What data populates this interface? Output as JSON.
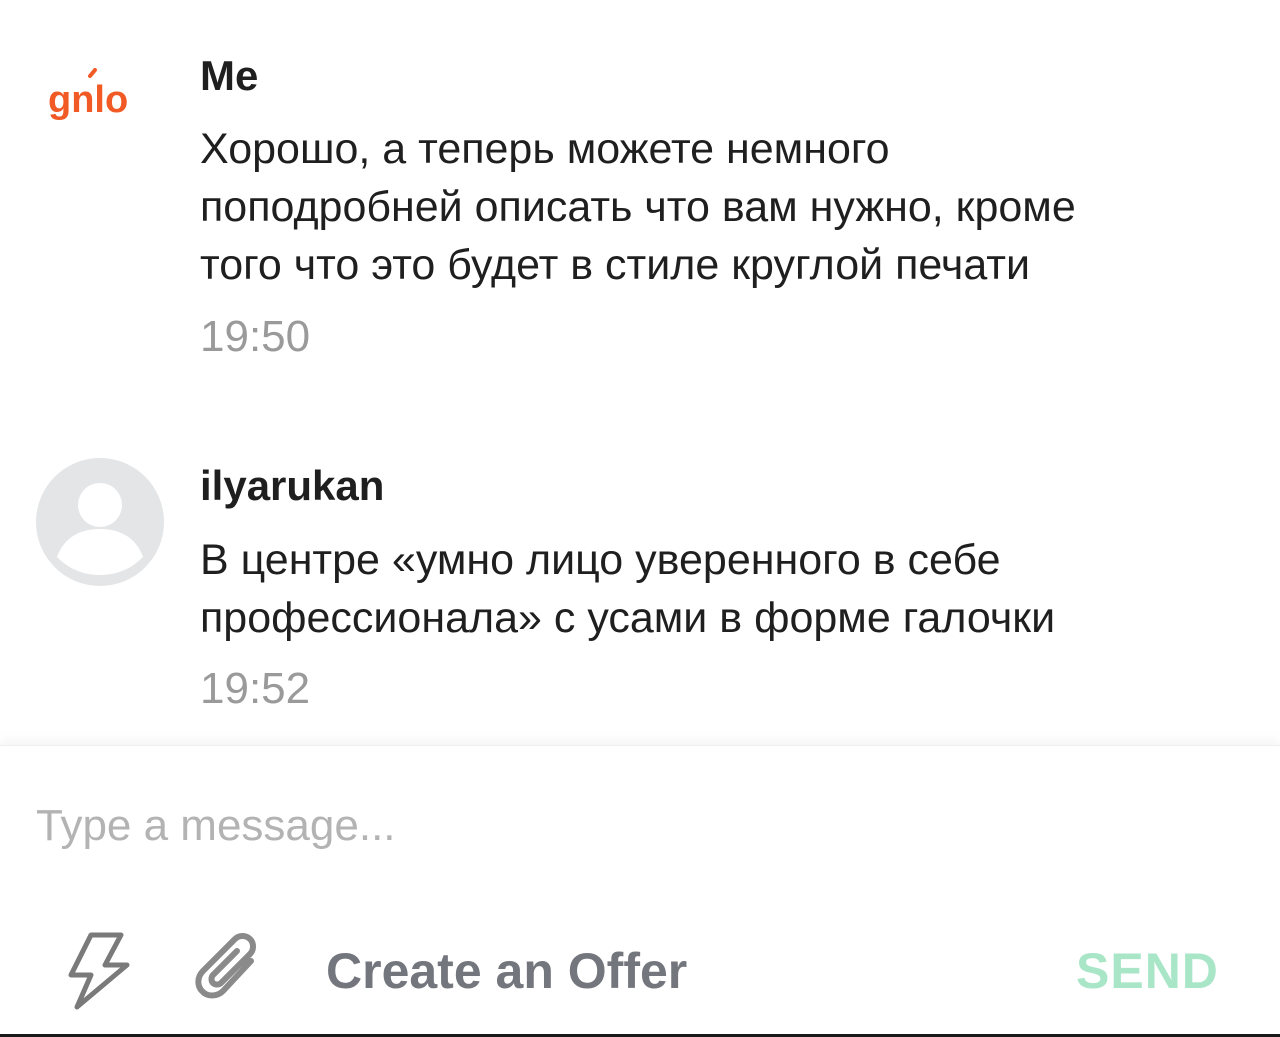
{
  "messages": [
    {
      "sender": "Me",
      "avatar": "gnlo-logo",
      "avatar_text": "gnlo",
      "lines": [
        "Хорошо, а теперь можете немного",
        "поподробней описать что вам нужно, кроме",
        "того что это будет в стиле круглой печати"
      ],
      "time": "19:50"
    },
    {
      "sender": "ilyarukan",
      "avatar": "user-placeholder-icon",
      "lines": [
        "В центре «умно лицо уверенного в себе",
        "профессионала» с усами в форме галочки"
      ],
      "time": "19:52"
    }
  ],
  "composer": {
    "placeholder": "Type a message...",
    "quick_response_icon": "bolt-icon",
    "attach_icon": "paperclip-icon",
    "offer_label": "Create an Offer",
    "send_label": "SEND"
  },
  "colors": {
    "brand_orange": "#f15a24",
    "send_disabled": "#a9e6c8",
    "text_primary": "#1f1f1f",
    "text_muted": "#9a9a9a",
    "avatar_placeholder": "#e4e5e7"
  }
}
